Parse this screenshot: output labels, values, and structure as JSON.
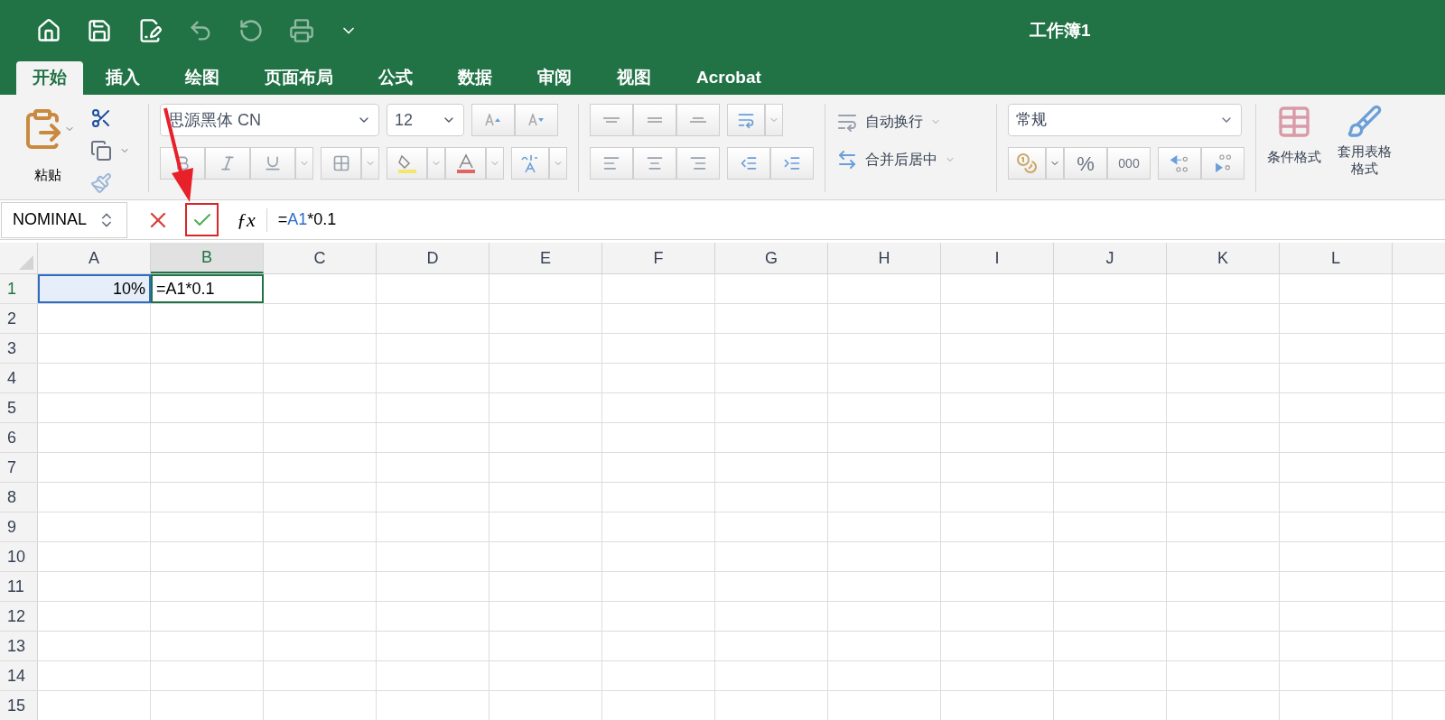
{
  "window": {
    "title": "工作簿1"
  },
  "tabs": [
    {
      "label": "开始",
      "selected": true
    },
    {
      "label": "插入",
      "selected": false
    },
    {
      "label": "绘图",
      "selected": false
    },
    {
      "label": "页面布局",
      "selected": false
    },
    {
      "label": "公式",
      "selected": false
    },
    {
      "label": "数据",
      "selected": false
    },
    {
      "label": "审阅",
      "selected": false
    },
    {
      "label": "视图",
      "selected": false
    },
    {
      "label": "Acrobat",
      "selected": false
    }
  ],
  "ribbon": {
    "paste_label": "粘贴",
    "font_name": "思源黑体 CN",
    "font_size": "12",
    "wrap_text": "自动换行",
    "merge_center": "合并后居中",
    "number_format": "常规",
    "percent": "%",
    "thousands": "000",
    "conditional_format": "条件格式",
    "table_format": "套用表格格式"
  },
  "formula_bar": {
    "name_box": "NOMINAL",
    "function_label": "ƒx",
    "formula": [
      {
        "kind": "plain",
        "text": "="
      },
      {
        "kind": "ref",
        "text": "A1"
      },
      {
        "kind": "plain",
        "text": "*0.1"
      }
    ]
  },
  "columns": [
    {
      "label": "A",
      "selected": false
    },
    {
      "label": "B",
      "selected": true
    },
    {
      "label": "C",
      "selected": false
    },
    {
      "label": "D",
      "selected": false
    },
    {
      "label": "E",
      "selected": false
    },
    {
      "label": "F",
      "selected": false
    },
    {
      "label": "G",
      "selected": false
    },
    {
      "label": "H",
      "selected": false
    },
    {
      "label": "I",
      "selected": false
    },
    {
      "label": "J",
      "selected": false
    },
    {
      "label": "K",
      "selected": false
    },
    {
      "label": "L",
      "selected": false
    }
  ],
  "rows": [
    {
      "label": "1",
      "selected": true,
      "cells": [
        {
          "value": "10%",
          "selected": false,
          "referenced": true
        },
        {
          "value": "=A1*0.1",
          "selected": true,
          "referenced": false
        }
      ]
    },
    {
      "label": "2",
      "selected": false
    },
    {
      "label": "3",
      "selected": false
    },
    {
      "label": "4",
      "selected": false
    },
    {
      "label": "5",
      "selected": false
    },
    {
      "label": "6",
      "selected": false
    },
    {
      "label": "7",
      "selected": false
    },
    {
      "label": "8",
      "selected": false
    },
    {
      "label": "9",
      "selected": false
    },
    {
      "label": "10",
      "selected": false
    },
    {
      "label": "11",
      "selected": false
    },
    {
      "label": "12",
      "selected": false
    },
    {
      "label": "13",
      "selected": false
    },
    {
      "label": "14",
      "selected": false
    },
    {
      "label": "15",
      "selected": false
    }
  ]
}
